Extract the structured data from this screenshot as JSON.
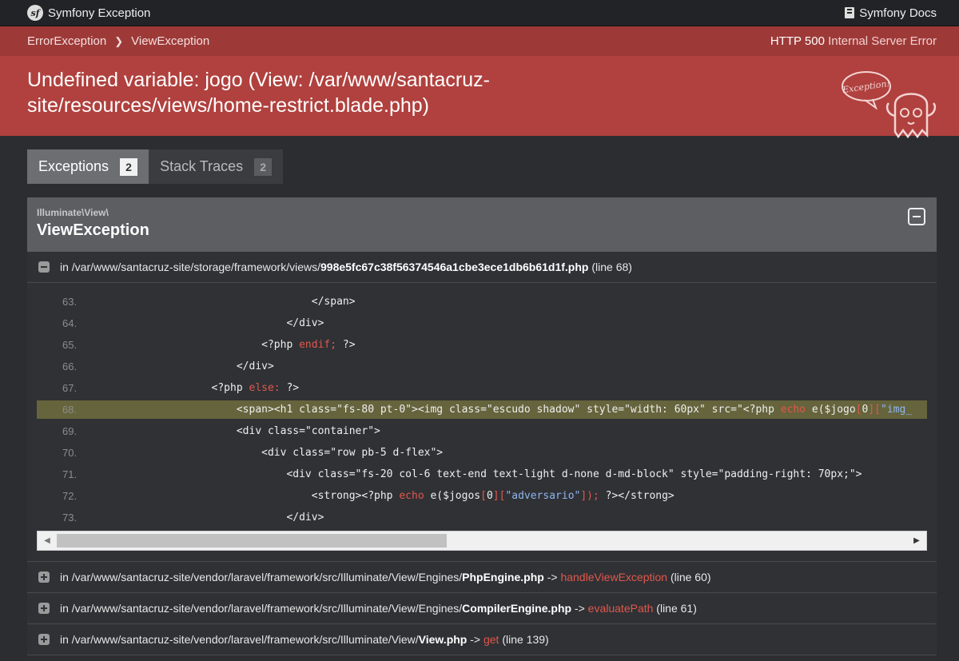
{
  "topbar": {
    "brand": "Symfony Exception",
    "docs": "Symfony Docs"
  },
  "header": {
    "crumbs": [
      "ErrorException",
      "ViewException"
    ],
    "status_code": "HTTP 500",
    "status_text": "Internal Server Error",
    "title": "Undefined variable: jogo (View: /var/www/santacruz-site/resources/views/home-restrict.blade.php)",
    "ghost_label": "Exception!"
  },
  "tabs": [
    {
      "label": "Exceptions",
      "count": "2"
    },
    {
      "label": "Stack Traces",
      "count": "2"
    }
  ],
  "exception": {
    "namespace": "Illuminate\\View\\",
    "name": "ViewException"
  },
  "frame0": {
    "prefix": "in /var/www/santacruz-site/storage/framework/views/",
    "file": "998e5fc67c38f56374546a1cbe3ece1db6b61d1f.php",
    "suffix": " (line 68)"
  },
  "code_lines": [
    {
      "num": "63.",
      "text": "                                    </span>"
    },
    {
      "num": "64.",
      "text": "                                </div>"
    },
    {
      "num": "65.",
      "pre": "                            <?php ",
      "kw": "endif;",
      "post": " ?>"
    },
    {
      "num": "66.",
      "text": "                        </div>"
    },
    {
      "num": "67.",
      "pre": "                    <?php ",
      "kw": "else:",
      "post": " ?>"
    },
    {
      "num": "68.",
      "pre": "                        <span><h1 class=\"fs-80 pt-0\"><img class=\"escudo shadow\" style=\"width: 60px\" src=\"<?php ",
      "kw": "echo",
      "mid": " e($jogo",
      "kw2": "[",
      "mid2": "0",
      "kw3": "][",
      "str": "\"img_"
    },
    {
      "num": "69.",
      "text": "                        <div class=\"container\">"
    },
    {
      "num": "70.",
      "text": "                            <div class=\"row pb-5 d-flex\">"
    },
    {
      "num": "71.",
      "text": "                                <div class=\"fs-20 col-6 text-end text-light d-none d-md-block\" style=\"padding-right: 70px;\">"
    },
    {
      "num": "72.",
      "pre": "                                    <strong><?php ",
      "kw": "echo",
      "mid": " e($jogos",
      "kw2": "[",
      "mid2": "0",
      "kw3": "][",
      "str": "\"adversario\"",
      "kw4": "]);",
      "post": " ?></strong>"
    },
    {
      "num": "73.",
      "text": "                                </div>"
    }
  ],
  "frames": [
    {
      "prefix": "in /var/www/santacruz-site/vendor/laravel/framework/src/Illuminate/View/Engines/",
      "file": "PhpEngine.php",
      "arrow": " -> ",
      "fn": "handleViewException",
      "suffix": " (line 60)"
    },
    {
      "prefix": "in /var/www/santacruz-site/vendor/laravel/framework/src/Illuminate/View/Engines/",
      "file": "CompilerEngine.php",
      "arrow": " -> ",
      "fn": "evaluatePath",
      "suffix": " (line 61)"
    },
    {
      "prefix": "in /var/www/santacruz-site/vendor/laravel/framework/src/Illuminate/View/",
      "file": "View.php",
      "arrow": " -> ",
      "fn": "get",
      "suffix": " (line 139)"
    }
  ],
  "colors": {
    "header_red": "#b0413e",
    "function_red": "#e2574c",
    "highlight": "#65643c"
  }
}
